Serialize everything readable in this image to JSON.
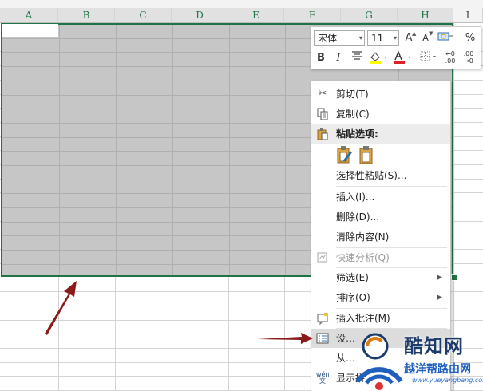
{
  "columns": [
    "A",
    "B",
    "C",
    "D",
    "E",
    "F",
    "G",
    "H",
    "I"
  ],
  "mini_toolbar": {
    "font_name": "宋体",
    "font_size": "11",
    "grow_font": "A",
    "shrink_font": "A",
    "percent": "%",
    "bold": "B",
    "italic": "I",
    "inc_decimal": "←0\n.00",
    "dec_decimal": ".00\n→0",
    "fill_color": "#ffff00",
    "font_color": "#e02020"
  },
  "context_menu": {
    "items": [
      {
        "label": "剪切(T)",
        "icon": "scissors-icon"
      },
      {
        "label": "复制(C)",
        "icon": "copy-icon"
      },
      {
        "label": "粘贴选项:",
        "icon": "paste-icon"
      },
      {
        "label": "选择性粘贴(S)..."
      },
      {
        "label": "插入(I)..."
      },
      {
        "label": "删除(D)..."
      },
      {
        "label": "清除内容(N)"
      },
      {
        "label": "快速分析(Q)",
        "icon": "quick-analysis-icon",
        "disabled": true
      },
      {
        "label": "筛选(E)"
      },
      {
        "label": "排序(O)"
      },
      {
        "label": "插入批注(M)",
        "icon": "comment-icon"
      },
      {
        "label": "设…",
        "icon": "format-cells-icon"
      },
      {
        "label": "从…"
      },
      {
        "label": "显示拼",
        "icon": "phonetic-icon"
      }
    ]
  },
  "watermark": {
    "brand": "酷知网",
    "site_cn": "越洋帮路由网",
    "site_url": "www.yueyangbang.com"
  },
  "colors": {
    "selection_border": "#217346",
    "arrow": "#8b1a1a"
  }
}
